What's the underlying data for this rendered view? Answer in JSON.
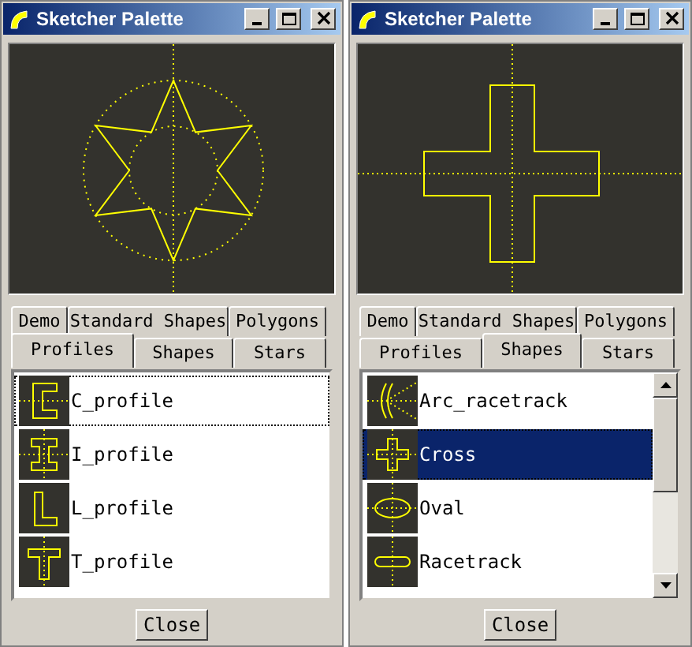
{
  "windows": [
    {
      "title": "Sketcher Palette",
      "preview": {
        "kind": "star"
      },
      "tab_rows": [
        [
          {
            "label": "Demo",
            "selected": false
          },
          {
            "label": "Standard Shapes",
            "selected": false
          },
          {
            "label": "Polygons",
            "selected": false
          }
        ],
        [
          {
            "label": "Profiles",
            "selected": true
          },
          {
            "label": "Shapes",
            "selected": false
          },
          {
            "label": "Stars",
            "selected": false
          }
        ]
      ],
      "list": {
        "scrollable": false,
        "items": [
          {
            "kind": "c_profile",
            "label": "C_profile",
            "selected": false,
            "focused": true
          },
          {
            "kind": "i_profile",
            "label": "I_profile",
            "selected": false,
            "focused": false
          },
          {
            "kind": "l_profile",
            "label": "L_profile",
            "selected": false,
            "focused": false
          },
          {
            "kind": "t_profile",
            "label": "T_profile",
            "selected": false,
            "focused": false
          }
        ]
      },
      "close_button": "Close"
    },
    {
      "title": "Sketcher Palette",
      "preview": {
        "kind": "cross"
      },
      "tab_rows": [
        [
          {
            "label": "Demo",
            "selected": false
          },
          {
            "label": "Standard Shapes",
            "selected": false
          },
          {
            "label": "Polygons",
            "selected": false
          }
        ],
        [
          {
            "label": "Profiles",
            "selected": false
          },
          {
            "label": "Shapes",
            "selected": true
          },
          {
            "label": "Stars",
            "selected": false
          }
        ]
      ],
      "list": {
        "scrollable": true,
        "items": [
          {
            "kind": "arc_racetrack",
            "label": "Arc_racetrack",
            "selected": false,
            "focused": false
          },
          {
            "kind": "cross",
            "label": "Cross",
            "selected": true,
            "focused": true
          },
          {
            "kind": "oval",
            "label": "Oval",
            "selected": false,
            "focused": false
          },
          {
            "kind": "racetrack",
            "label": "Racetrack",
            "selected": false,
            "focused": false
          }
        ]
      },
      "close_button": "Close"
    }
  ]
}
